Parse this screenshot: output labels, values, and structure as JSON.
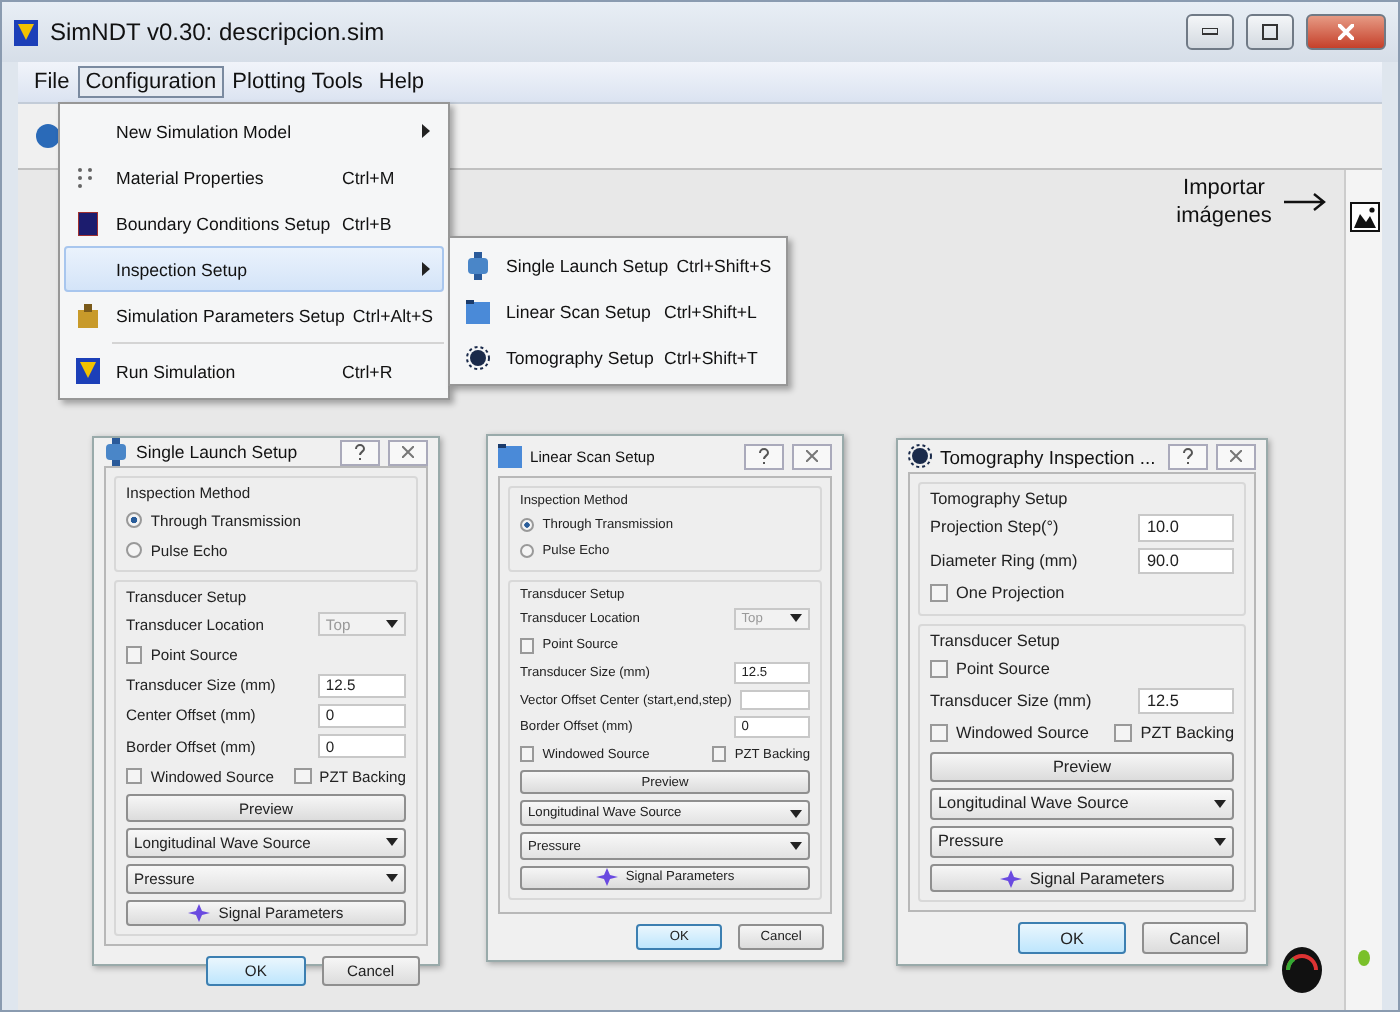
{
  "window": {
    "title": "SimNDT v0.30: descripcion.sim"
  },
  "menu": [
    {
      "label": "File",
      "selected": false
    },
    {
      "label": "Configuration",
      "selected": true
    },
    {
      "label": "Plotting Tools",
      "selected": false
    },
    {
      "label": "Help",
      "selected": false
    }
  ],
  "config_menu": [
    {
      "label": "New Simulation Model",
      "kind": "submenu",
      "selected": false
    },
    {
      "label": "Material Properties",
      "shortcut": "Ctrl+M",
      "kind": "item",
      "selected": false
    },
    {
      "label": "Boundary Conditions Setup",
      "shortcut": "Ctrl+B",
      "kind": "item",
      "selected": false
    },
    {
      "label": "Inspection Setup",
      "kind": "submenu",
      "selected": true
    },
    {
      "label": "Simulation Parameters Setup",
      "shortcut": "Ctrl+Alt+S",
      "kind": "item",
      "selected": false
    },
    {
      "kind": "separator"
    },
    {
      "label": "Run Simulation",
      "shortcut": "Ctrl+R",
      "kind": "item",
      "selected": false
    }
  ],
  "inspection_submenu": [
    {
      "label": "Single Launch Setup",
      "shortcut": "Ctrl+Shift+S"
    },
    {
      "label": "Linear Scan Setup",
      "shortcut": "Ctrl+Shift+L"
    },
    {
      "label": "Tomography Setup",
      "shortcut": "Ctrl+Shift+T"
    }
  ],
  "annotation": "Importar imágenes",
  "dialogs": [
    {
      "title": "Single Launch Setup",
      "sections": [
        {
          "title": "Inspection Method",
          "rows": [
            {
              "kind": "radio",
              "label": "Through Transmission",
              "selected": true
            },
            {
              "kind": "radio",
              "label": "Pulse Echo",
              "selected": false
            }
          ]
        },
        {
          "title": "Transducer Setup",
          "rows": [
            {
              "kind": "select",
              "label": "Transducer Location",
              "value": "Top",
              "disabled": true
            },
            {
              "kind": "checkbox",
              "label": "Point Source",
              "checked": false
            },
            {
              "kind": "field",
              "label": "Transducer Size (mm)",
              "value": "12.5"
            },
            {
              "kind": "field",
              "label": "Center Offset (mm)",
              "value": "0"
            },
            {
              "kind": "field",
              "label": "Border Offset (mm)",
              "value": "0"
            },
            {
              "kind": "checkpair",
              "items": [
                {
                  "label": "Windowed Source",
                  "checked": false
                },
                {
                  "label": "PZT Backing",
                  "checked": false
                }
              ]
            },
            {
              "kind": "button",
              "label": "Preview"
            },
            {
              "kind": "dropdown",
              "value": "Longitudinal Wave Source"
            },
            {
              "kind": "dropdown",
              "value": "Pressure"
            },
            {
              "kind": "signal",
              "label": "Signal Parameters"
            }
          ]
        }
      ],
      "buttons": [
        "OK",
        "Cancel"
      ]
    },
    {
      "title": "Linear Scan Setup",
      "sections": [
        {
          "title": "Inspection Method",
          "rows": [
            {
              "kind": "radio",
              "label": "Through Transmission",
              "selected": true
            },
            {
              "kind": "radio",
              "label": "Pulse Echo",
              "selected": false
            }
          ]
        },
        {
          "title": "Transducer Setup",
          "rows": [
            {
              "kind": "select",
              "label": "Transducer Location",
              "value": "Top",
              "disabled": true
            },
            {
              "kind": "checkbox",
              "label": "Point Source",
              "checked": false
            },
            {
              "kind": "field",
              "label": "Transducer Size (mm)",
              "value": "12.5"
            },
            {
              "kind": "field",
              "label": "Vector Offset Center (start,end,step)"
            },
            {
              "kind": "field",
              "label": "Border Offset (mm)",
              "value": "0"
            },
            {
              "kind": "checkpair",
              "items": [
                {
                  "label": "Windowed Source",
                  "checked": false
                },
                {
                  "label": "PZT Backing",
                  "checked": false
                }
              ]
            },
            {
              "kind": "button",
              "label": "Preview"
            },
            {
              "kind": "dropdown",
              "value": "Longitudinal Wave Source"
            },
            {
              "kind": "dropdown",
              "value": "Pressure"
            },
            {
              "kind": "signal",
              "label": "Signal Parameters"
            }
          ]
        }
      ],
      "buttons": [
        "OK",
        "Cancel"
      ]
    },
    {
      "title": "Tomography Inspection ...",
      "sections": [
        {
          "title": "Tomography Setup",
          "rows": [
            {
              "kind": "field",
              "label": "Projection Step(°)",
              "value": "10.0"
            },
            {
              "kind": "field",
              "label": "Diameter Ring (mm)",
              "value": "90.0"
            },
            {
              "kind": "checkbox",
              "label": "One Projection",
              "checked": false
            }
          ]
        },
        {
          "title": "Transducer Setup",
          "rows": [
            {
              "kind": "checkbox",
              "label": "Point Source",
              "checked": false
            },
            {
              "kind": "field",
              "label": "Transducer Size (mm)",
              "value": "12.5"
            },
            {
              "kind": "checkpair",
              "items": [
                {
                  "label": "Windowed Source",
                  "checked": false
                },
                {
                  "label": "PZT Backing",
                  "checked": false
                }
              ]
            },
            {
              "kind": "button",
              "label": "Preview"
            },
            {
              "kind": "dropdown",
              "value": "Longitudinal Wave Source"
            },
            {
              "kind": "dropdown",
              "value": "Pressure"
            },
            {
              "kind": "signal",
              "label": "Signal Parameters"
            }
          ]
        }
      ],
      "buttons": [
        "OK",
        "Cancel"
      ]
    }
  ]
}
